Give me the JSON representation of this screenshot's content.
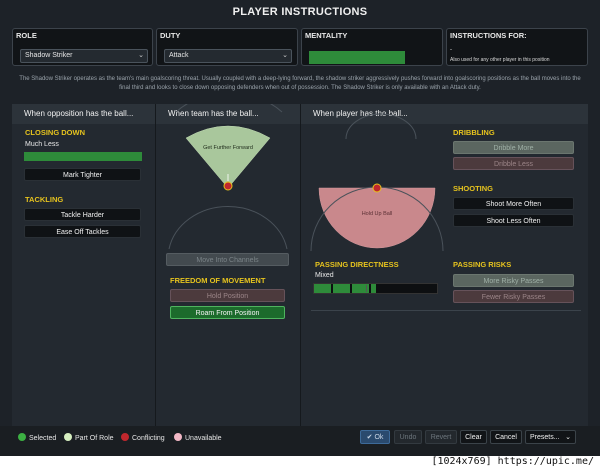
{
  "title": "PLAYER INSTRUCTIONS",
  "role": {
    "label": "ROLE",
    "value": "Shadow Striker"
  },
  "duty": {
    "label": "DUTY",
    "value": "Attack"
  },
  "mentality": {
    "label": "MENTALITY",
    "color": "#2e8b3a"
  },
  "instructions_for": {
    "label": "INSTRUCTIONS FOR:",
    "value": "-",
    "note": "Also used for any other player in this position"
  },
  "description": "The Shadow Striker operates as the team's main goalscoring threat. Usually coupled with a deep-lying forward, the shadow striker aggressively pushes forward into goalscoring positions as the ball moves into the final third and looks to close down opposing defenders when out of possession. The Shadow Striker is only available with an Attack duty.",
  "panels": {
    "opposition": {
      "header": "When opposition has the ball...",
      "closing_down": {
        "title": "CLOSING DOWN",
        "value": "Much Less",
        "level": 1.0
      },
      "mark_tighter": "Mark Tighter",
      "tackling": {
        "title": "TACKLING",
        "harder": "Tackle Harder",
        "ease_off": "Ease Off Tackles"
      }
    },
    "team": {
      "header": "When team has the ball...",
      "pitch_zone": "Get Further Forward",
      "channels": "Move Into Channels",
      "freedom": {
        "title": "FREEDOM OF MOVEMENT",
        "hold": "Hold Position",
        "roam": "Roam From Position"
      }
    },
    "player": {
      "header": "When player has the ball...",
      "pitch_zone": "Hold Up Ball",
      "dribbling": {
        "title": "DRIBBLING",
        "more": "Dribble More",
        "less": "Dribble Less"
      },
      "shooting": {
        "title": "SHOOTING",
        "more": "Shoot More Often",
        "less": "Shoot Less Often"
      },
      "passing_directness": {
        "title": "PASSING DIRECTNESS",
        "value": "Mixed",
        "level": 0.5
      },
      "passing_risks": {
        "title": "PASSING RISKS",
        "more": "More Risky Passes",
        "fewer": "Fewer Risky Passes"
      }
    }
  },
  "legend": {
    "selected": {
      "label": "Selected",
      "color": "#3cb043"
    },
    "part_of_role": {
      "label": "Part Of Role",
      "color": "#d6efc0"
    },
    "conflicting": {
      "label": "Conflicting",
      "color": "#c0272d"
    },
    "unavailable": {
      "label": "Unavailable",
      "color": "#f2b8c6"
    }
  },
  "actions": {
    "ok": "Ok",
    "undo": "Undo",
    "revert": "Revert",
    "clear": "Clear",
    "cancel": "Cancel",
    "presets": "Presets..."
  },
  "watermark": "[1024x769] https://upic.me/"
}
